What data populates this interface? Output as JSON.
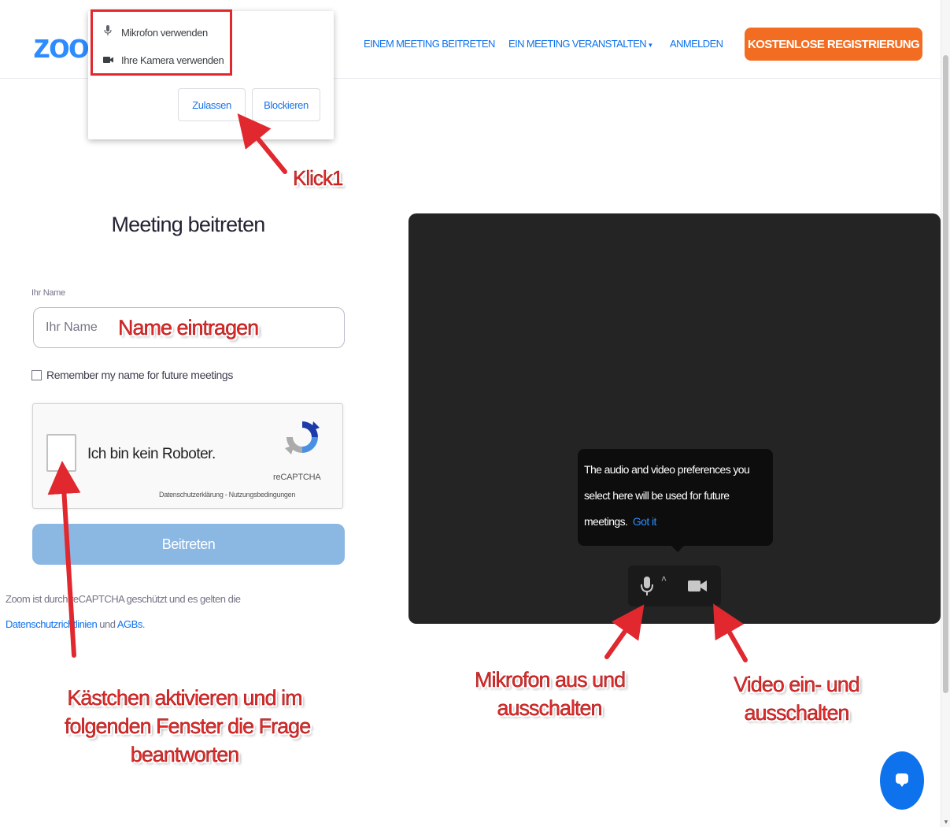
{
  "header": {
    "logo": "zoo",
    "nav": {
      "join": "EINEM MEETING BEITRETEN",
      "host": "EIN MEETING VERANSTALTEN",
      "host_caret": "▾",
      "signin": "ANMELDEN",
      "signup": "KOSTENLOSE REGISTRIERUNG"
    }
  },
  "permission_popup": {
    "items": [
      "Mikrofon verwenden",
      "Ihre Kamera verwenden"
    ],
    "allow": "Zulassen",
    "block": "Blockieren"
  },
  "join_form": {
    "title": "Meeting beitreten",
    "name_label": "Ihr Name",
    "name_placeholder": "Ihr Name",
    "remember": "Remember my name for future meetings",
    "captcha": {
      "label": "Ich bin kein Roboter.",
      "brand": "reCAPTCHA",
      "links": "Datenschutzerklärung - Nutzungsbedingungen"
    },
    "submit": "Beitreten",
    "legal": {
      "text1": "Zoom ist durch reCAPTCHA geschützt und es gelten die",
      "privacy_link": "Datenschutzrichtlinien",
      "and": " und ",
      "terms_link": "AGBs",
      "period": "."
    }
  },
  "preview": {
    "tooltip": {
      "line1": "The audio and video preferences you",
      "line2": "select here will be used for future",
      "line3": "meetings.",
      "got_it": "Got it"
    },
    "caret": "˄"
  },
  "annotations": {
    "click1": "Klick1",
    "name": "Name eintragen",
    "checkbox": [
      "Kästchen aktivieren und im",
      "folgenden Fenster die Frage",
      "beantworten"
    ],
    "mic": [
      "Mikrofon aus und",
      "ausschalten"
    ],
    "video": [
      "Video ein- und",
      "ausschalten"
    ]
  },
  "colors": {
    "zoom_blue": "#2d8cff",
    "signup_orange": "#f26d21",
    "annotation_red": "#e22a2a",
    "preview_bg": "#242424"
  }
}
